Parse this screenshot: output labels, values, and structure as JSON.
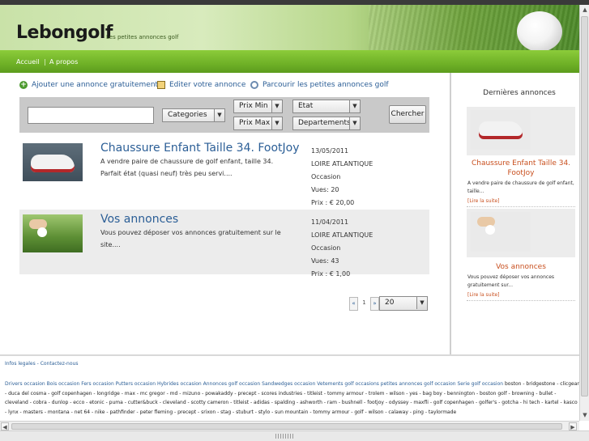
{
  "header": {
    "logo": "Lebongolf",
    "tagline": "Les petites annonces golf"
  },
  "nav": {
    "items": [
      "Accueil",
      "A propos"
    ],
    "separator": "|"
  },
  "actions": {
    "add": "Ajouter une annonce gratuitement",
    "edit": "Editer votre annonce",
    "browse": "Parcourir les petites annonces golf"
  },
  "search": {
    "input_value": "",
    "categories": "Categories",
    "prix_min": "Prix Min",
    "prix_max": "Prix Max",
    "etat": "Etat",
    "departements": "Departements",
    "button": "Chercher"
  },
  "listings": [
    {
      "title": "Chaussure Enfant Taille 34. FootJoy",
      "description": "A vendre paire de chaussure de golf enfant, taille 34. Parfait état (quasi neuf) très peu servi....",
      "date": "13/05/2011",
      "region": "LOIRE ATLANTIQUE",
      "condition": "Occasion",
      "views": "Vues: 20",
      "price": "Prix : € 20,00"
    },
    {
      "title": "Vos annonces",
      "description": "Vous pouvez déposer vos annonces gratuitement sur le site....",
      "date": "11/04/2011",
      "region": "LOIRE ATLANTIQUE",
      "condition": "Occasion",
      "views": "Vues: 43",
      "price": "Prix : € 1,00"
    }
  ],
  "pagination": {
    "prev": "«",
    "current": "1",
    "next": "»",
    "per_page": "20"
  },
  "sidebar": {
    "title": "Dernières annonces",
    "items": [
      {
        "name": "Chaussure Enfant Taille 34. FootJoy",
        "description": "A vendre paire de chaussure de golf enfant, taille...",
        "more": "[Lire la suite]"
      },
      {
        "name": "Vos annonces",
        "description": "Vous pouvez déposer vos annonces gratuitement sur...",
        "more": "[Lire la suite]"
      }
    ]
  },
  "footer": {
    "links": "Infos legales - Contactez-nous",
    "categories": "Drivers occasion Bois occasion Fers occasion Putters occasion Hybrides occasion Annonces golf occasion Sandwedges occasion Vetements golf occasions petites annonces golf occasion Serie golf occasion",
    "brands": "boston - bridgestone - clicgear - duca del cosma - golf copenhagen - longridge - max - mc gregor - md - mizuno - powakaddy - precept - scores industries - titleist - tommy armour - trolem - wilson - yes - bag boy - bennington - boston golf - browning - bullet - cleveland - cobra - dunlop - ecco - etonic - puma - cutter&buck - cleveland - scotty cameron - titleist - adidas - spalding - ashworth - ram - bushnell - footjoy - odyssey - maxfli - golf copenhagen - golfer's - gotcha - hi tech - kartel - kasco - lynx - masters - montana - net 64 - nike - pathfinder - peter fleming - precept - srixon - stag - stuburt - stylo - sun mountain - tommy armour - golf - wilson - calaway - ping - taylormade"
  },
  "scroll": {
    "up": "▲",
    "down": "▼",
    "left": "◀",
    "right": "▶"
  }
}
